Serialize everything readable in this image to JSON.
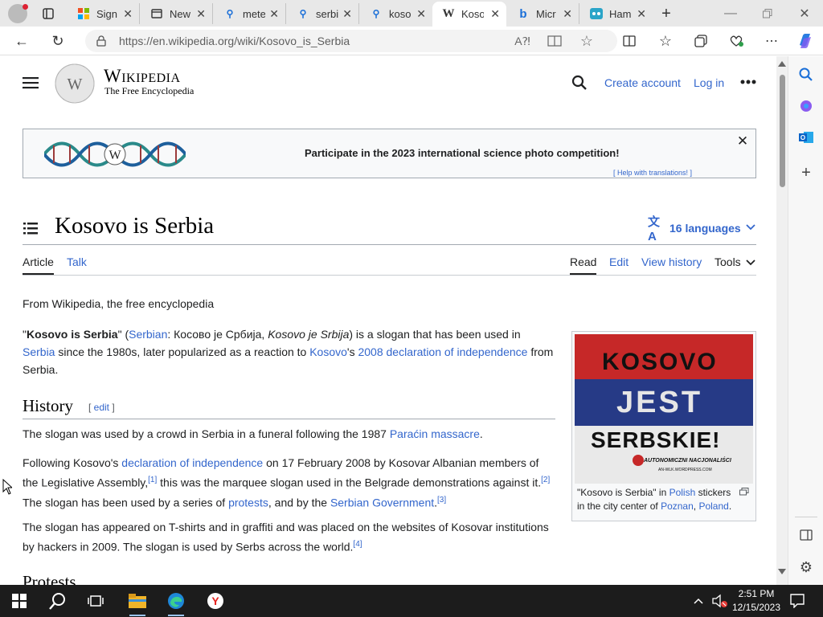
{
  "browser": {
    "tabs": [
      {
        "title": "Sign",
        "favicon": "microsoft-logo-icon"
      },
      {
        "title": "New",
        "favicon": "new-tab-icon"
      },
      {
        "title": "mete",
        "favicon": "search-icon"
      },
      {
        "title": "serbi",
        "favicon": "search-icon"
      },
      {
        "title": "koso",
        "favicon": "search-icon"
      },
      {
        "title": "Koso",
        "favicon": "wikipedia-icon",
        "active": true
      },
      {
        "title": "Micr",
        "favicon": "bing-icon"
      },
      {
        "title": "Ham",
        "favicon": "hamster-icon"
      }
    ],
    "url": "https://en.wikipedia.org/wiki/Kosovo_is_Serbia"
  },
  "wiki": {
    "wordmark": "Wikipedia",
    "tagline": "The Free Encyclopedia",
    "create_account": "Create account",
    "log_in": "Log in",
    "banner_text": "Participate in the 2023 international science photo competition!",
    "banner_help": "[ Help with translations! ]",
    "title": "Kosovo is Serbia",
    "languages": "16 languages",
    "tabs": {
      "article": "Article",
      "talk": "Talk",
      "read": "Read",
      "edit": "Edit",
      "history": "View history",
      "tools": "Tools"
    },
    "from": "From Wikipedia, the free encyclopedia",
    "lead": {
      "quote_open": "\"",
      "bold": "Kosovo is Serbia",
      "quote_close": "\" (",
      "serbian_link": "Serbian",
      "cyrillic": ": Косово је Србија, ",
      "italic": "Kosovo je Srbija",
      "after_italic": ") is a slogan that has been used in",
      "serbia_link": "Serbia",
      "since": " since the 1980s, later popularized as a reaction to ",
      "kosovo_link": "Kosovo",
      "poss": "'s ",
      "decl_link": "2008 declaration of independence",
      "from": " from",
      "end": "Serbia."
    },
    "history_heading": "History",
    "edit_link": "edit",
    "p1_a": "The slogan was used by a crowd in Serbia in a funeral following the 1987 ",
    "p1_link": "Paraćin massacre",
    "p1_end": ".",
    "p2_a": "Following Kosovo's ",
    "p2_link1": "declaration of independence",
    "p2_b": " on 17 February 2008 by Kosovar Albanian members of",
    "p2_c": "the Legislative Assembly,",
    "ref1": "[1]",
    "p2_d": " this was the marquee slogan used in the Belgrade demonstrations against it.",
    "ref2": "[2]",
    "p2_e": "The slogan has been used by a series of ",
    "p2_link2": "protests",
    "p2_f": ", and by the ",
    "p2_link3": "Serbian Government",
    "p2_g": ".",
    "ref3": "[3]",
    "p3_a": "The slogan has appeared on T-shirts and in graffiti and was placed on the websites of Kosovar institutions",
    "p3_b": "by hackers in 2009. The slogan is used by Serbs across the world.",
    "ref4": "[4]",
    "next_heading": "Protests",
    "figure": {
      "sticker_line1": "KOSOVO",
      "sticker_line2": "JEST",
      "sticker_line3": "SERBSKIE!",
      "sticker_small1": "AUTONOMICZNI NACJONALIŚCI",
      "sticker_small2": "AN-WLK.WORDPRESS.COM",
      "cap_a": "\"Kosovo is Serbia\" in ",
      "cap_link1": "Polish",
      "cap_b": " stickers",
      "cap_c": "in the city center of ",
      "cap_link2": "Poznan",
      "cap_d": ", ",
      "cap_link3": "Poland",
      "cap_e": "."
    }
  },
  "taskbar": {
    "time": "2:51 PM",
    "date": "12/15/2023"
  },
  "colors": {
    "link": "#3366cc",
    "accent": "#0078d4",
    "taskbar": "#1c1c1c"
  }
}
